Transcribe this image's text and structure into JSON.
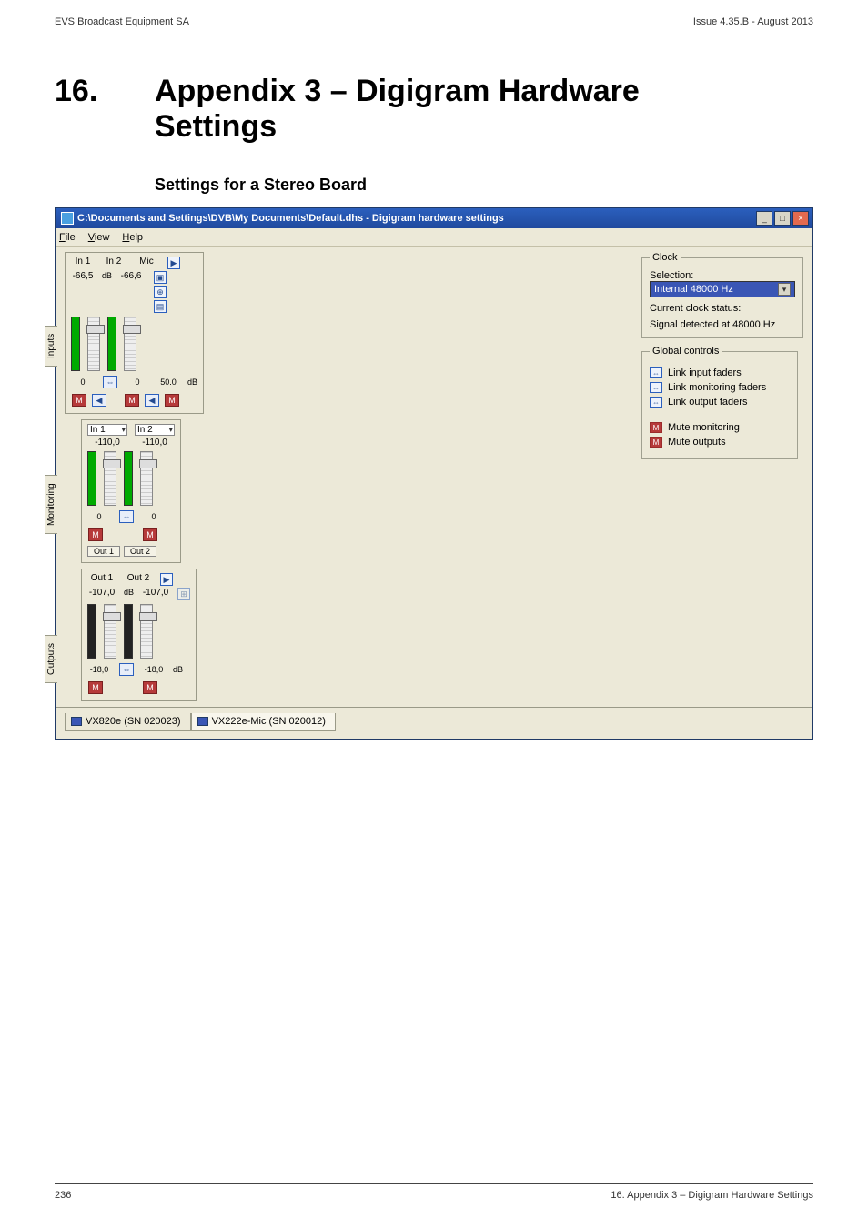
{
  "header": {
    "left": "EVS Broadcast Equipment SA",
    "right": "Issue 4.35.B - August 2013"
  },
  "chapter": {
    "number": "16.",
    "title_line1": "Appendix 3 – Digigram Hardware",
    "title_line2": "Settings"
  },
  "subheading": "Settings for a Stereo Board",
  "window": {
    "title": "C:\\Documents and Settings\\DVB\\My Documents\\Default.dhs - Digigram hardware settings",
    "menu": {
      "file": "File",
      "view": "View",
      "help": "Help"
    },
    "btn_min": "_",
    "btn_max": "□",
    "btn_close": "×"
  },
  "inputs": {
    "label": "Inputs",
    "col1": "In 1",
    "col2": "In 2",
    "col3": "Mic",
    "v1": "-66,5",
    "v2": "-66,6",
    "bot1": "0",
    "bot2": "0",
    "bot3": "50.0",
    "m": "M",
    "link": "⇔",
    "play": "▶",
    "tl": "◀"
  },
  "monitoring": {
    "label": "Monitoring",
    "sel1": "In 1",
    "sel2": "In 2",
    "v1": "-110,0",
    "v2": "-110,0",
    "bot1": "0",
    "bot2": "0",
    "out1": "Out 1",
    "out2": "Out 2",
    "m": "M",
    "link": "⇔"
  },
  "outputs": {
    "label": "Outputs",
    "col1": "Out 1",
    "col2": "Out 2",
    "v1": "-107,0",
    "v2": "-107,0",
    "bot1": "-18,0",
    "bot2": "-18,0",
    "m": "M",
    "link": "⇔",
    "play": "▶"
  },
  "clock": {
    "legend": "Clock",
    "selection_label": "Selection:",
    "selection_value": "Internal 48000 Hz",
    "status_label": "Current clock status:",
    "status_value": "Signal detected at 48000 Hz"
  },
  "global": {
    "legend": "Global controls",
    "link_input": "Link input faders",
    "link_monitoring": "Link monitoring faders",
    "link_output": "Link output faders",
    "mute_monitoring": "Mute monitoring",
    "mute_outputs": "Mute outputs",
    "link": "⇔",
    "mute": "M"
  },
  "tabs": {
    "tab1": "VX820e (SN 020023)",
    "tab2": "VX222e-Mic (SN 020012)"
  },
  "footer": {
    "left": "236",
    "right": "16. Appendix 3 – Digigram Hardware Settings"
  }
}
